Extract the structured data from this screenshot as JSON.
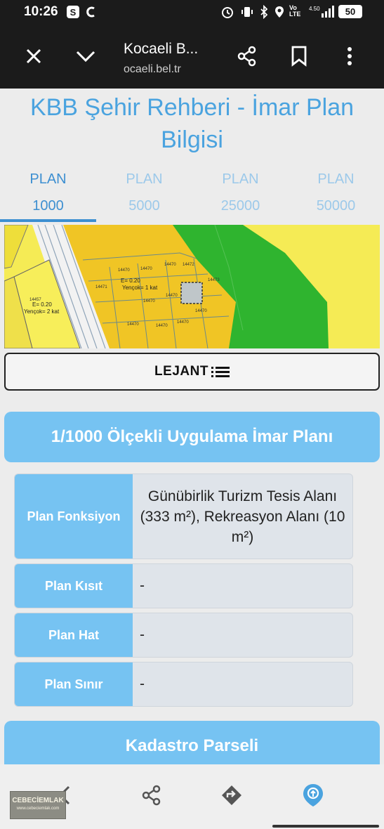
{
  "status_bar": {
    "time": "10:26",
    "battery": "50",
    "network": "Vo LTE",
    "speed": "4.50 K/s"
  },
  "toolbar": {
    "title": "Kocaeli B...",
    "url": "ocaeli.bel.tr",
    "icons": [
      "close-icon",
      "chevron-down-icon",
      "share-icon",
      "bookmark-icon",
      "more-vert-icon"
    ]
  },
  "page": {
    "title": "KBB Şehir Rehberi - İmar Plan Bilgisi",
    "tabs": [
      {
        "line1": "PLAN",
        "line2": "1000",
        "active": true
      },
      {
        "line1": "PLAN",
        "line2": "5000",
        "active": false
      },
      {
        "line1": "PLAN",
        "line2": "25000",
        "active": false
      },
      {
        "line1": "PLAN",
        "line2": "50000",
        "active": false
      }
    ],
    "map_labels": {
      "left_parcel_e": "E= 0.20",
      "left_parcel_h": "Yençok= 2 kat",
      "center_parcel_e": "E= 0.20",
      "center_parcel_h": "Yençok= 1 kat"
    },
    "legend_button": "LEJANT",
    "plan_section": {
      "heading": "1/1000 Ölçekli Uygulama İmar Planı",
      "rows": [
        {
          "key": "Plan Fonksiyon",
          "value": "Günübirlik Turizm Tesis Alanı (333 m²), Rekreasyon Alanı (10 m²)"
        },
        {
          "key": "Plan Kısıt",
          "value": "-"
        },
        {
          "key": "Plan Hat",
          "value": "-"
        },
        {
          "key": "Plan Sınır",
          "value": "-"
        }
      ]
    },
    "cadastre_section": {
      "heading": "Kadastro Parseli"
    }
  },
  "watermark": {
    "line1": "CEBECİEMLAK",
    "line2": "www.cebeciemlak.com"
  },
  "bottom_nav": {
    "icons": [
      "back-arrow-icon",
      "share-icon",
      "directions-icon",
      "location-pin-icon"
    ]
  },
  "colors": {
    "accent_blue": "#76c3f2",
    "title_blue": "#4aa3df",
    "map_yellow": "#f5eb55",
    "map_green": "#2fb42f"
  }
}
